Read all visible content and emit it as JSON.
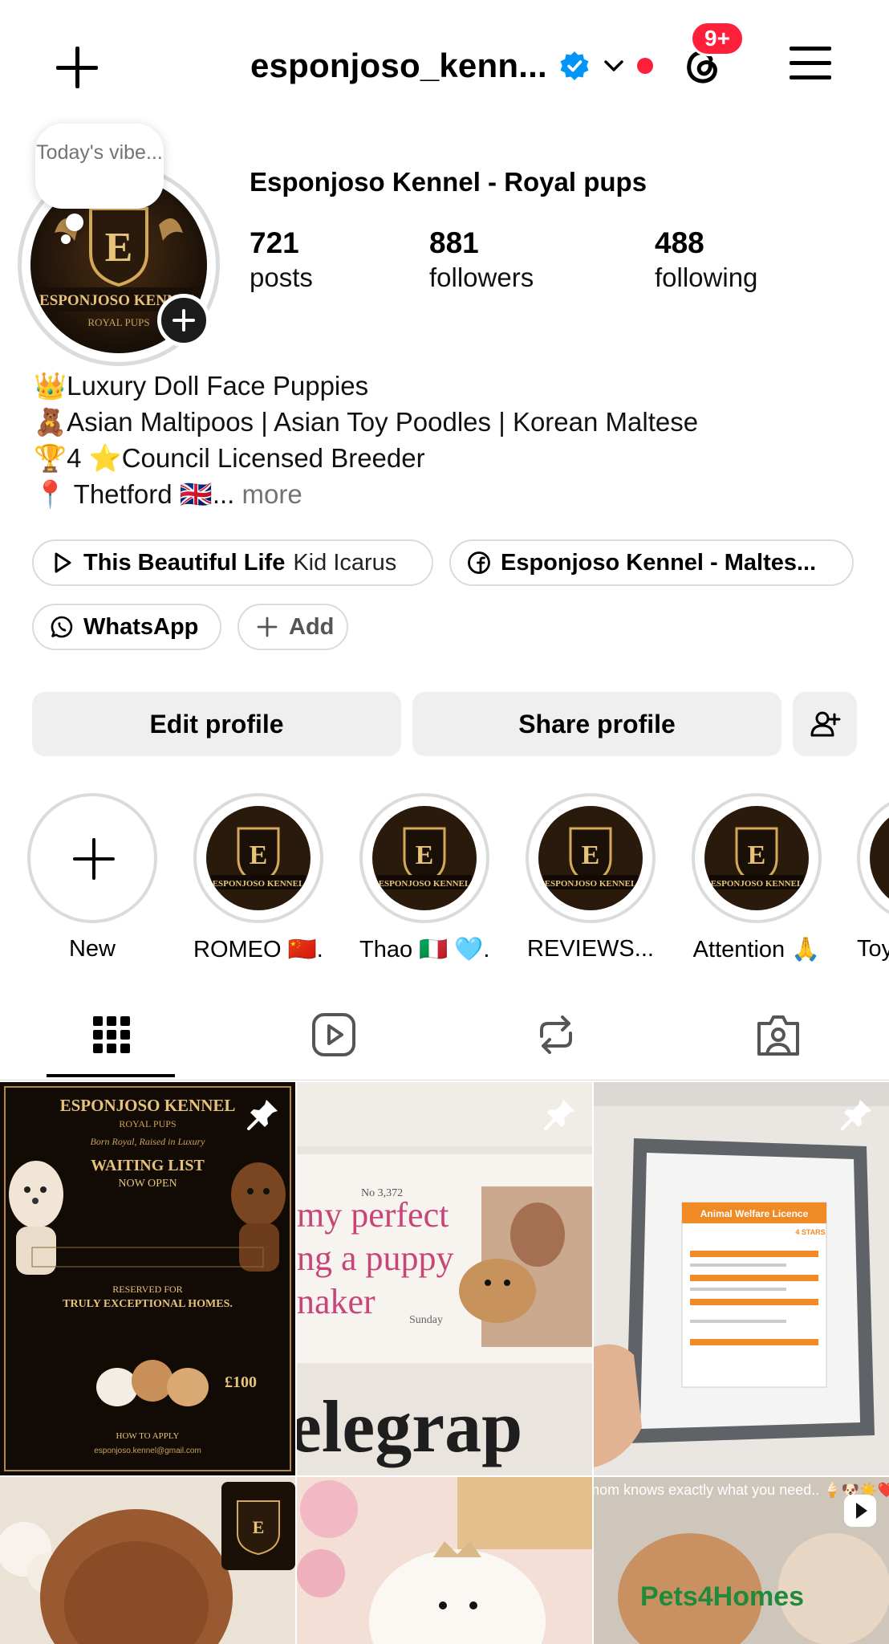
{
  "header": {
    "username": "esponjoso_kenn...",
    "notification_badge": "9+"
  },
  "profile": {
    "note": "Today's vibe...",
    "display_name": "Esponjoso Kennel - Royal pups",
    "stats": [
      {
        "value": "721",
        "label": "posts"
      },
      {
        "value": "881",
        "label": "followers"
      },
      {
        "value": "488",
        "label": "following"
      }
    ],
    "bio": [
      {
        "emoji": "👑",
        "text": "Luxury Doll Face Puppies"
      },
      {
        "emoji": "🧸",
        "text": "Asian Maltipoos | Asian Toy Poodles | Korean Maltese"
      },
      {
        "emoji": "🏆",
        "text": "4 ⭐Council Licensed Breeder"
      },
      {
        "emoji": "📍",
        "text": " Thetford 🇬🇧..."
      }
    ],
    "bio_more": "more"
  },
  "links": {
    "music_title": "This Beautiful Life",
    "music_artist": "Kid Icarus",
    "facebook": "Esponjoso Kennel - Maltes...",
    "whatsapp": "WhatsApp",
    "add": "Add"
  },
  "buttons": {
    "edit": "Edit profile",
    "share": "Share profile"
  },
  "highlights": [
    {
      "label": "New"
    },
    {
      "label": "ROMEO 🇨🇳..."
    },
    {
      "label": "Thao 🇮🇹 🩵..."
    },
    {
      "label": "REVIEWS..."
    },
    {
      "label": "Attention 🙏"
    },
    {
      "label": "Toy"
    }
  ],
  "logo": {
    "letter": "E",
    "name": "ESPONJOSO KENNEL",
    "tagline": "ROYAL PUPS"
  },
  "posts": {
    "p1": {
      "title": "ESPONJOSO KENNEL",
      "sub": "ROYAL PUPS",
      "motto": "Born Royal, Raised in Luxury",
      "headline": "WAITING LIST",
      "headline2": "NOW OPEN",
      "reserved": "RESERVED FOR",
      "reserved2": "TRULY EXCEPTIONAL HOMES.",
      "price": "£100",
      "apply": "HOW TO APPLY",
      "email": "esponjoso.kennel@gmail.com"
    },
    "p2": {
      "issue": "No 3,372",
      "line1": "my perfect",
      "line2": "ng a puppy",
      "line3": "naker",
      "day": "Sunday",
      "masthead": "elegrap"
    },
    "p3": {
      "doc_title": "Animal Welfare Licence",
      "rating": "4 STARS"
    },
    "p6": {
      "caption": "mom knows exactly what you need.. 🍦🐶☀️❤️",
      "watermark": "Pets4Homes"
    }
  },
  "colors": {
    "accent_red": "#ff1f3a",
    "verified_blue": "#0095f6",
    "gold": "#c9a15a",
    "button_bg": "#efefef"
  }
}
